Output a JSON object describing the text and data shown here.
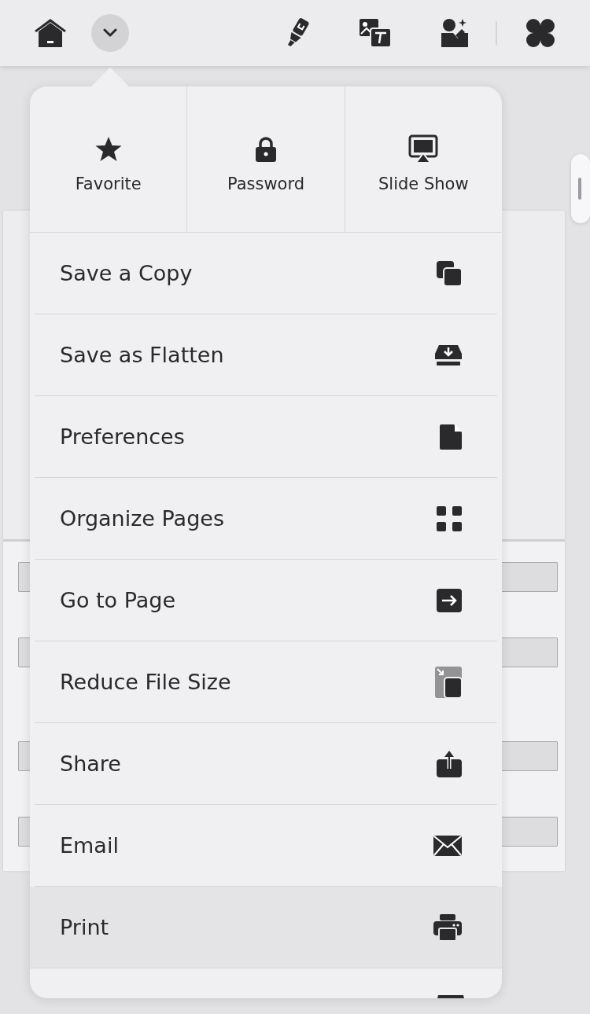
{
  "toolbar": {
    "menu_open": true
  },
  "quick_actions": [
    {
      "label": "Favorite"
    },
    {
      "label": "Password"
    },
    {
      "label": "Slide Show"
    }
  ],
  "menu_items": [
    {
      "label": "Save a Copy",
      "selected": false
    },
    {
      "label": "Save as Flatten",
      "selected": false
    },
    {
      "label": "Preferences",
      "selected": false
    },
    {
      "label": "Organize Pages",
      "selected": false
    },
    {
      "label": "Go to Page",
      "selected": false
    },
    {
      "label": "Reduce File Size",
      "selected": false
    },
    {
      "label": "Share",
      "selected": false
    },
    {
      "label": "Email",
      "selected": false
    },
    {
      "label": "Print",
      "selected": true
    }
  ]
}
